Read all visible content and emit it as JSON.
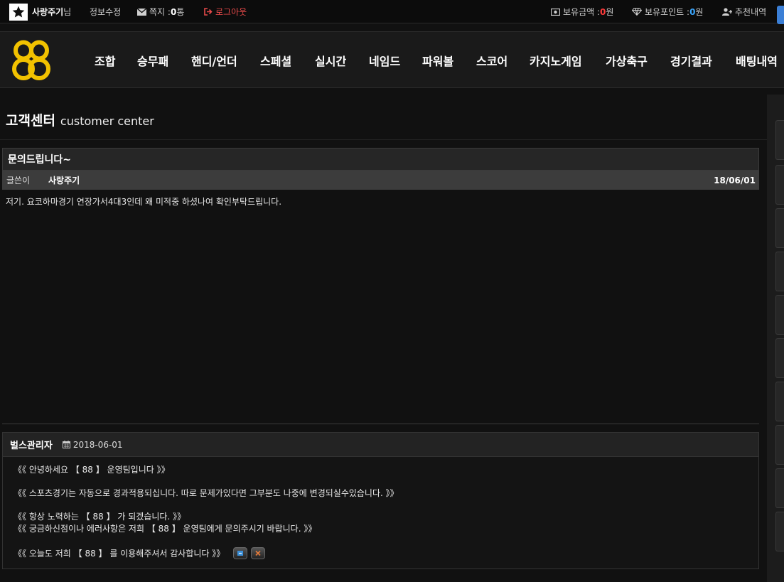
{
  "topbar": {
    "username": "사랑주기",
    "username_suffix": "님",
    "edit_info": "정보수정",
    "messages_label": "쪽지 : ",
    "messages_count": "0",
    "messages_unit": " 통",
    "logout": "로그아웃",
    "balance_label": "보유금액 : ",
    "balance_value": "0",
    "balance_unit": "원",
    "points_label": "보유포인트 : ",
    "points_value": "0",
    "points_unit": "원",
    "referral": "추천내역"
  },
  "nav": {
    "logo_text": "88",
    "items": [
      "조합",
      "승무패",
      "핸디/언더",
      "스페셜",
      "실시간",
      "네임드",
      "파워볼",
      "스코어",
      "카지노게임",
      "가상축구",
      "경기결과",
      "배팅내역"
    ]
  },
  "page": {
    "title_ko": "고객센터",
    "title_en": "customer center"
  },
  "post": {
    "title": "문의드립니다~",
    "author_label": "글쓴이",
    "author": "사랑주기",
    "date": "18/06/01",
    "body": "저기. 요코하마경기 연장가서4대3인데 왜 미적중 하셨나여 확인부탁드립니다."
  },
  "reply": {
    "author": "벌스관리자",
    "date": "2018-06-01",
    "lines": [
      "《《 안녕하세요 【 88 】 운영팀입니다 》》",
      "《《 스포츠경기는 자동으로 경과적용되십니다. 따로 문제가있다면 그부분도 나중에 변경되실수있습니다. 》》",
      "《《 항상 노력하는 【 88 】 가 되겠습니다. 》》",
      "《《 궁금하신점이나 에러사항은 저희 【 88 】 운영팀에게 문의주시기 바랍니다. 》》",
      "《《 오늘도 저희 【 88 】 를 이용해주셔서 감사합니다 》》"
    ]
  },
  "colors": {
    "accent_red": "#ff3b3b",
    "accent_blue": "#3ba7ff",
    "logo_gold": "#f2c200"
  }
}
